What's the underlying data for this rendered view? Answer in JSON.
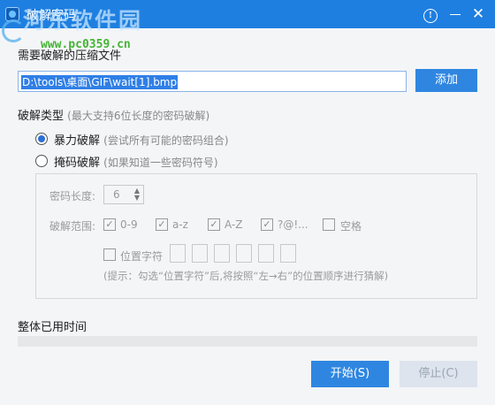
{
  "window": {
    "title": "破解密码"
  },
  "watermark": {
    "site_name": "河东软件园",
    "url": "www.pc0359.cn"
  },
  "file": {
    "label": "需要破解的压缩文件",
    "path": "D:\\tools\\桌面\\GIF\\wait[1].bmp",
    "add_label": "添加"
  },
  "crack_type": {
    "label": "破解类型",
    "hint": "(最大支持6位长度的密码破解)",
    "brute_label": "暴力破解",
    "brute_hint": "(尝试所有可能的密码组合)",
    "mask_label": "掩码破解",
    "mask_hint": "(如果知道一些密码符号)",
    "selected": "brute"
  },
  "options": {
    "length_label": "密码长度:",
    "length_value": "6",
    "range_label": "破解范围:",
    "ranges": [
      {
        "label": "0-9",
        "checked": true
      },
      {
        "label": "a-z",
        "checked": true
      },
      {
        "label": "A-Z",
        "checked": true
      },
      {
        "label": "?@!...",
        "checked": true
      },
      {
        "label": "空格",
        "checked": false
      }
    ],
    "position_label": "位置字符",
    "position_checked": false,
    "tip": "(提示：勾选“位置字符”后,将按照“左→右”的位置顺序进行猜解)"
  },
  "time": {
    "label": "整体已用时间",
    "progress": 0
  },
  "buttons": {
    "start": "开始(S)",
    "stop": "停止(C)"
  },
  "colors": {
    "accent": "#2f86e0",
    "titlebar": "#1e7fe0"
  }
}
